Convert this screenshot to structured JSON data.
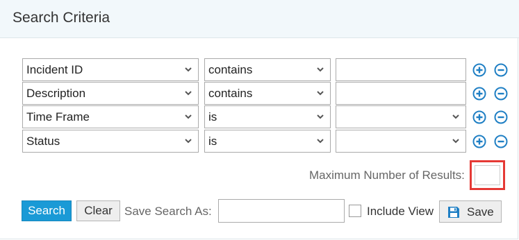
{
  "header": {
    "title": "Search Criteria"
  },
  "criteria": [
    {
      "field": "Incident ID",
      "operator": "contains",
      "value": "",
      "value_type": "text"
    },
    {
      "field": "Description",
      "operator": "contains",
      "value": "",
      "value_type": "text"
    },
    {
      "field": "Time Frame",
      "operator": "is",
      "value": "",
      "value_type": "select"
    },
    {
      "field": "Status",
      "operator": "is",
      "value": "",
      "value_type": "select"
    }
  ],
  "max_results": {
    "label": "Maximum Number of Results:",
    "value": ""
  },
  "actions": {
    "search_label": "Search",
    "clear_label": "Clear",
    "save_search_as_label": "Save Search As:",
    "save_search_as_value": "",
    "include_view_label": "Include View",
    "include_view_checked": false,
    "save_label": "Save"
  },
  "colors": {
    "accent": "#1a9ad6",
    "icon_blue": "#1f7fc4",
    "highlight_red": "#e53935",
    "header_bg": "#f2f8fb"
  },
  "icons": {
    "add": "plus-circle-icon",
    "remove": "minus-circle-icon",
    "dropdown": "chevron-down-icon",
    "save": "floppy-disk-icon"
  }
}
